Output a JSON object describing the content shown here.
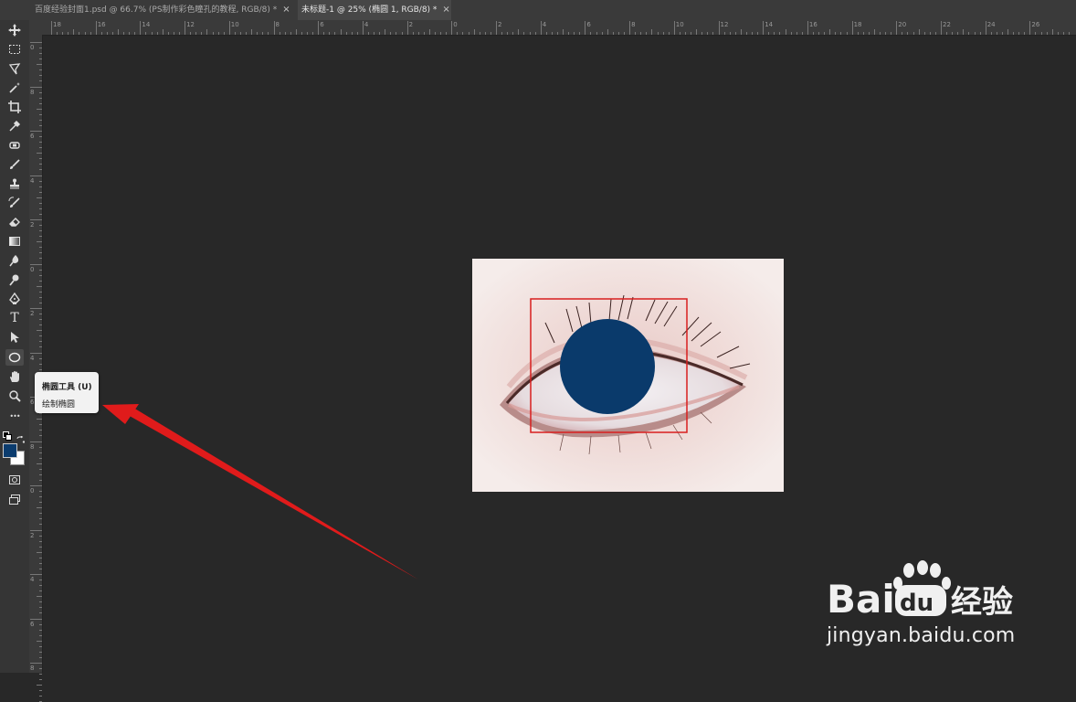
{
  "tabs": [
    {
      "label": "百度经验封面1.psd @ 66.7% (PS制作彩色瞳孔的教程, RGB/8) *",
      "close": "×"
    },
    {
      "label": "未标题-1 @ 25% (椭圆 1, RGB/8) *",
      "close": "×"
    }
  ],
  "ruler_top_labels": [
    "18",
    "16",
    "14",
    "12",
    "10",
    "8",
    "6",
    "4",
    "2",
    "0",
    "2",
    "4",
    "6",
    "8",
    "10",
    "12",
    "14",
    "16",
    "18",
    "20",
    "22",
    "24",
    "26"
  ],
  "ruler_left_labels": [
    "0",
    "8",
    "6",
    "4",
    "2",
    "0",
    "2",
    "4",
    "6",
    "8",
    "0",
    "2",
    "4",
    "6",
    "8"
  ],
  "tools": [
    {
      "name": "move-tool",
      "icon": "move-icon"
    },
    {
      "name": "marquee-tool",
      "icon": "rect-marquee-icon"
    },
    {
      "name": "lasso-tool",
      "icon": "lasso-icon"
    },
    {
      "name": "magic-wand-tool",
      "icon": "magic-wand-icon"
    },
    {
      "name": "crop-tool",
      "icon": "crop-icon"
    },
    {
      "name": "eyedropper-tool",
      "icon": "eyedropper-icon"
    },
    {
      "name": "healing-tool",
      "icon": "bandage-icon"
    },
    {
      "name": "brush-tool",
      "icon": "brush-icon"
    },
    {
      "name": "stamp-tool",
      "icon": "stamp-icon"
    },
    {
      "name": "history-brush-tool",
      "icon": "history-brush-icon"
    },
    {
      "name": "eraser-tool",
      "icon": "eraser-icon"
    },
    {
      "name": "gradient-tool",
      "icon": "gradient-icon"
    },
    {
      "name": "blur-tool",
      "icon": "drop-icon"
    },
    {
      "name": "dodge-tool",
      "icon": "dodge-icon"
    },
    {
      "name": "pen-tool",
      "icon": "pen-icon"
    },
    {
      "name": "type-tool",
      "icon": "type-icon"
    },
    {
      "name": "path-select-tool",
      "icon": "arrow-cursor-icon"
    },
    {
      "name": "ellipse-tool",
      "icon": "ellipse-icon"
    },
    {
      "name": "hand-tool",
      "icon": "hand-icon"
    },
    {
      "name": "zoom-tool",
      "icon": "zoom-icon"
    },
    {
      "name": "more-tools",
      "icon": "more-icon"
    }
  ],
  "type_tool_glyph": "T",
  "more_glyph": "•••",
  "colors": {
    "foreground": "#0b3c6e",
    "background": "#ffffff",
    "pupil": "#0a3a6b",
    "highlight_box": "#d81e1e",
    "arrow": "#e01b1b"
  },
  "tooltip": {
    "title": "椭圆工具 (U)",
    "description": "绘制椭圆"
  },
  "watermark": {
    "brand": "Bai du 经验",
    "url": "jingyan.baidu.com"
  }
}
